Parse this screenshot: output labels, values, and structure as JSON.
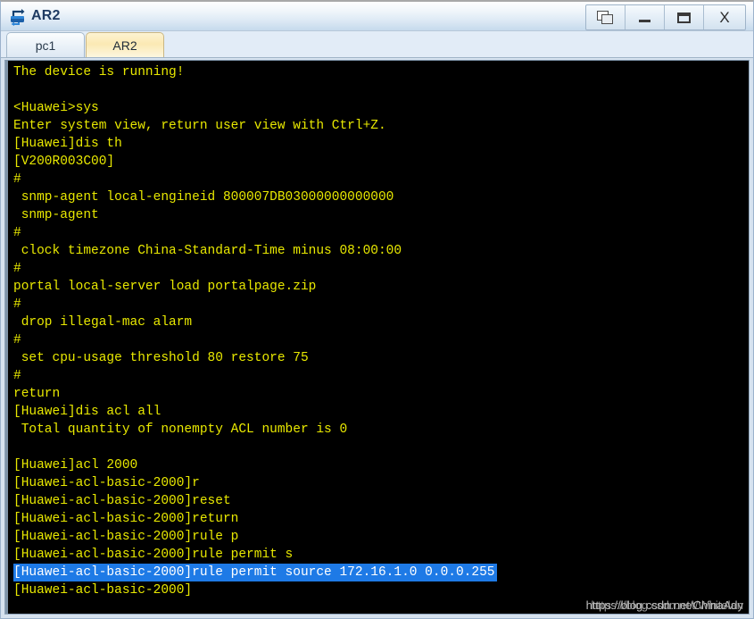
{
  "window": {
    "title": "AR2",
    "icon": "router-device-icon",
    "controls": [
      {
        "name": "restore-window-button",
        "icon": "restore-icon",
        "label": ""
      },
      {
        "name": "minimize-window-button",
        "icon": "minimize-icon",
        "label": ""
      },
      {
        "name": "maximize-window-button",
        "icon": "maximize-icon",
        "label": ""
      },
      {
        "name": "close-window-button",
        "icon": "close-icon",
        "label": "X"
      }
    ]
  },
  "tabs": [
    {
      "label": "pc1",
      "active": false
    },
    {
      "label": "AR2",
      "active": true
    }
  ],
  "terminal": {
    "foreground_color": "#e8e800",
    "background_color": "#000000",
    "selection_color": "#1e7ae6",
    "selection_text_color": "#ffffff",
    "lines": [
      {
        "text": "The device is running!",
        "selected": false
      },
      {
        "text": "",
        "selected": false
      },
      {
        "text": "<Huawei>sys",
        "selected": false
      },
      {
        "text": "Enter system view, return user view with Ctrl+Z.",
        "selected": false
      },
      {
        "text": "[Huawei]dis th",
        "selected": false
      },
      {
        "text": "[V200R003C00]",
        "selected": false
      },
      {
        "text": "#",
        "selected": false
      },
      {
        "text": " snmp-agent local-engineid 800007DB03000000000000",
        "selected": false
      },
      {
        "text": " snmp-agent",
        "selected": false
      },
      {
        "text": "#",
        "selected": false
      },
      {
        "text": " clock timezone China-Standard-Time minus 08:00:00",
        "selected": false
      },
      {
        "text": "#",
        "selected": false
      },
      {
        "text": "portal local-server load portalpage.zip",
        "selected": false
      },
      {
        "text": "#",
        "selected": false
      },
      {
        "text": " drop illegal-mac alarm",
        "selected": false
      },
      {
        "text": "#",
        "selected": false
      },
      {
        "text": " set cpu-usage threshold 80 restore 75",
        "selected": false
      },
      {
        "text": "#",
        "selected": false
      },
      {
        "text": "return",
        "selected": false
      },
      {
        "text": "[Huawei]dis acl all",
        "selected": false
      },
      {
        "text": " Total quantity of nonempty ACL number is 0",
        "selected": false
      },
      {
        "text": "",
        "selected": false
      },
      {
        "text": "[Huawei]acl 2000",
        "selected": false
      },
      {
        "text": "[Huawei-acl-basic-2000]r",
        "selected": false
      },
      {
        "text": "[Huawei-acl-basic-2000]reset",
        "selected": false
      },
      {
        "text": "[Huawei-acl-basic-2000]return",
        "selected": false
      },
      {
        "text": "[Huawei-acl-basic-2000]rule p",
        "selected": false
      },
      {
        "text": "[Huawei-acl-basic-2000]rule permit s",
        "selected": false
      },
      {
        "text": "[Huawei-acl-basic-2000]rule permit source 172.16.1.0 0.0.0.255",
        "selected": true
      },
      {
        "text": "[Huawei-acl-basic-2000]",
        "selected": false
      }
    ]
  },
  "watermark": {
    "primary": "https://blog.csdn.net/ChinaAdy",
    "secondary": "https://blog.csdn.net/Whitelan"
  }
}
